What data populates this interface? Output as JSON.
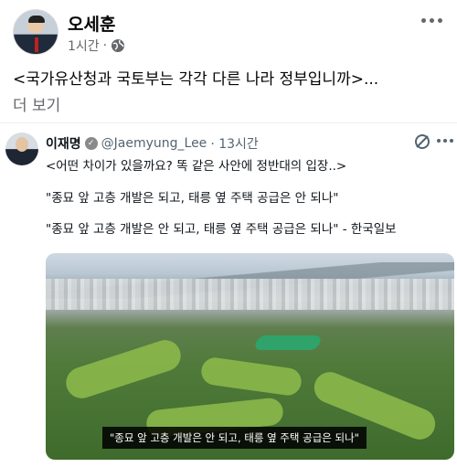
{
  "post": {
    "author": "오세훈",
    "time": "1시간",
    "separator": "·",
    "text": "<국가유산청과 국토부는 각각 다른 나라 정부입니까>...",
    "see_more": "더 보기"
  },
  "embed": {
    "name": "이재명",
    "verified_mark": "✓",
    "handle": "@Jaemyung_Lee",
    "time": "· 13시간",
    "line1": "<어떤 차이가 있을까요? 똑 같은 사안에 정반대의 입장..>",
    "line2": "\"종묘 앞 고층 개발은 되고, 태릉 옆 주택 공급은 안 되나\"",
    "line3": "\"종묘 앞 고층 개발은 안 되고, 태릉 옆 주택 공급은 되나\" - 한국일보",
    "image_caption": "\"종묘 앞 고층 개발은 안 되고, 태릉 옆 주택 공급은 되나\""
  },
  "icons": {
    "privacy": "globe-icon",
    "options": "more-icon",
    "verified": "verified-icon",
    "grok": "grok-icon"
  }
}
